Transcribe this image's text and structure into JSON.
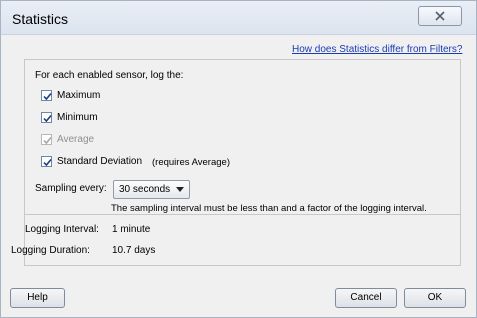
{
  "window": {
    "title": "Statistics"
  },
  "help_link": "How does Statistics differ from Filters?",
  "log_header": "For each enabled sensor, log the:",
  "options": [
    {
      "label": "Maximum",
      "checked": true,
      "disabled": false
    },
    {
      "label": "Minimum",
      "checked": true,
      "disabled": false
    },
    {
      "label": "Average",
      "checked": true,
      "disabled": true
    },
    {
      "label": "Standard Deviation",
      "checked": true,
      "disabled": false,
      "note": "(requires Average)"
    }
  ],
  "sampling": {
    "label": "Sampling every:",
    "value": "30 seconds",
    "hint": "The sampling interval must be less than and a factor of the logging interval."
  },
  "logging": {
    "interval_label": "Logging Interval:",
    "interval_value": "1 minute",
    "duration_label": "Logging Duration:",
    "duration_value": "10.7 days"
  },
  "buttons": {
    "help": "Help",
    "cancel": "Cancel",
    "ok": "OK"
  },
  "icons": {
    "close": "close-icon",
    "check": "checkmark-icon",
    "dropdown": "chevron-down-icon"
  }
}
